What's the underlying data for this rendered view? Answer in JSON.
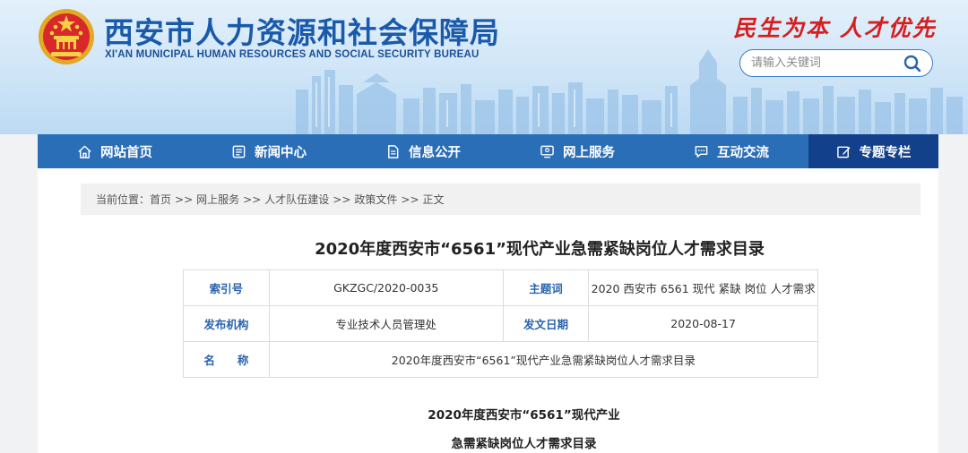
{
  "header": {
    "title_cn": "西安市人力资源和社会保障局",
    "title_en": "XI'AN MUNICIPAL HUMAN RESOURCES AND SOCIAL SECURITY BUREAU",
    "slogan": "民生为本 人才优先",
    "search": {
      "placeholder": "请输入关键词",
      "icon": "search-icon"
    }
  },
  "nav": {
    "items": [
      {
        "label": "网站首页",
        "icon": "home-icon"
      },
      {
        "label": "新闻中心",
        "icon": "news-icon"
      },
      {
        "label": "信息公开",
        "icon": "document-icon"
      },
      {
        "label": "网上服务",
        "icon": "service-icon"
      },
      {
        "label": "互动交流",
        "icon": "chat-icon"
      },
      {
        "label": "专题专栏",
        "icon": "edit-icon"
      }
    ],
    "active_index": 5
  },
  "breadcrumb": {
    "prefix": "当前位置：",
    "items": [
      "首页",
      "网上服务",
      "人才队伍建设",
      "政策文件",
      "正文"
    ],
    "separator": ">>"
  },
  "article": {
    "title": "2020年度西安市“6561”现代产业急需紧缺岗位人才需求目录",
    "meta": {
      "index_label": "索引号",
      "index_value": "GKZGC/2020-0035",
      "subject_label": "主题词",
      "subject_value": "2020 西安市 6561 现代 紧缺 岗位 人才需求",
      "publisher_label": "发布机构",
      "publisher_value": "专业技术人员管理处",
      "date_label": "发文日期",
      "date_value": "2020-08-17",
      "name_label": "名　　称",
      "name_value": "2020年度西安市“6561”现代产业急需紧缺岗位人才需求目录"
    },
    "body_line1": "2020年度西安市“6561”现代产业",
    "body_line2": "急需紧缺岗位人才需求目录"
  },
  "colors": {
    "nav_bg": "#2a6eb8",
    "nav_active": "#13408a",
    "title_blue": "#1a5aab",
    "slogan_red": "#d51e1e",
    "label_blue": "#2a64ad"
  }
}
